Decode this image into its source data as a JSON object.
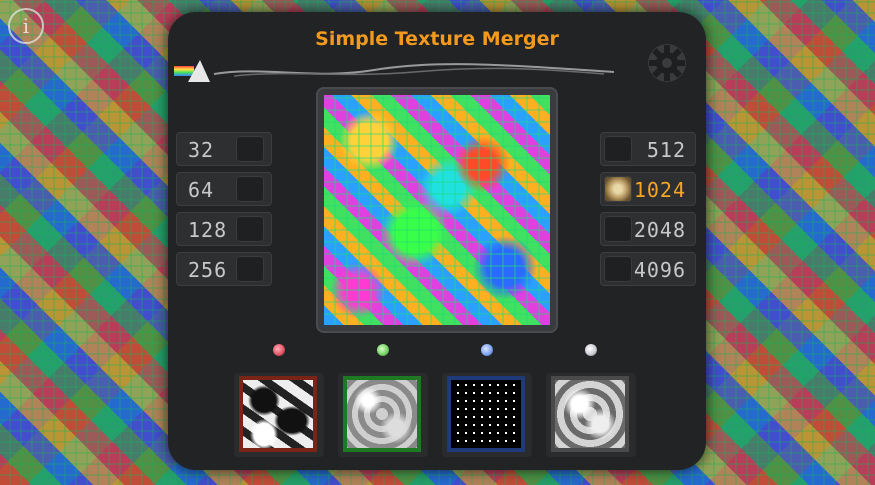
{
  "app": {
    "title": "Simple Texture Merger",
    "info_icon": "info-icon",
    "info_label": "i",
    "settings_icon": "gear-icon"
  },
  "sizes_left": [
    {
      "label": "32",
      "selected": false
    },
    {
      "label": "64",
      "selected": false
    },
    {
      "label": "128",
      "selected": false
    },
    {
      "label": "256",
      "selected": false
    }
  ],
  "sizes_right": [
    {
      "label": "512",
      "selected": false
    },
    {
      "label": "1024",
      "selected": true
    },
    {
      "label": "2048",
      "selected": false
    },
    {
      "label": "4096",
      "selected": false
    }
  ],
  "channels": [
    {
      "name": "red",
      "color": "#e05060",
      "texture_border": "#7a2418"
    },
    {
      "name": "green",
      "color": "#70d060",
      "texture_border": "#1d7a22"
    },
    {
      "name": "blue",
      "color": "#7aa0f0",
      "texture_border": "#1e3a7a"
    },
    {
      "name": "alpha",
      "color": "#c8c8d0",
      "texture_border": "#4a4a4a"
    }
  ],
  "colors": {
    "accent": "#f29a1e",
    "panel": "#222325"
  }
}
